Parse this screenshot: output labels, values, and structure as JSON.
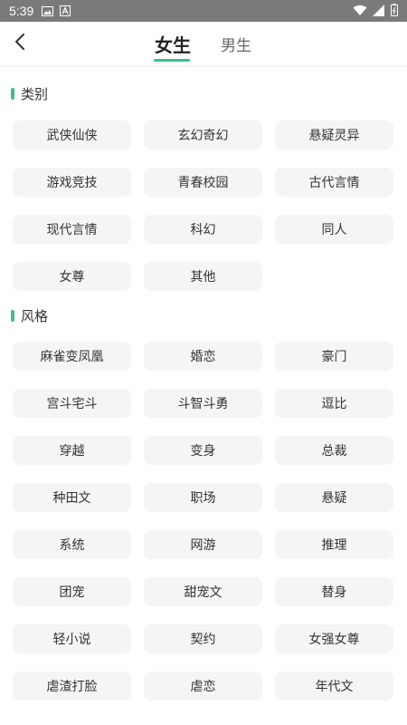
{
  "status_bar": {
    "time": "5:39",
    "icons": [
      "image-icon",
      "a-text-icon",
      "wifi-icon",
      "signal-icon",
      "battery-icon"
    ]
  },
  "header": {
    "tabs": [
      {
        "label": "女生",
        "active": true
      },
      {
        "label": "男生",
        "active": false
      }
    ],
    "accent_color": "#3cc08b"
  },
  "sections": [
    {
      "title": "类别",
      "items": [
        "武侠仙侠",
        "玄幻奇幻",
        "悬疑灵异",
        "游戏竞技",
        "青春校园",
        "古代言情",
        "现代言情",
        "科幻",
        "同人",
        "女尊",
        "其他"
      ]
    },
    {
      "title": "风格",
      "items": [
        "麻雀变凤凰",
        "婚恋",
        "豪门",
        "宫斗宅斗",
        "斗智斗勇",
        "逗比",
        "穿越",
        "变身",
        "总裁",
        "种田文",
        "职场",
        "悬疑",
        "系统",
        "网游",
        "推理",
        "团宠",
        "甜宠文",
        "替身",
        "轻小说",
        "契约",
        "女强女尊",
        "虐渣打脸",
        "虐恋",
        "年代文"
      ]
    }
  ]
}
